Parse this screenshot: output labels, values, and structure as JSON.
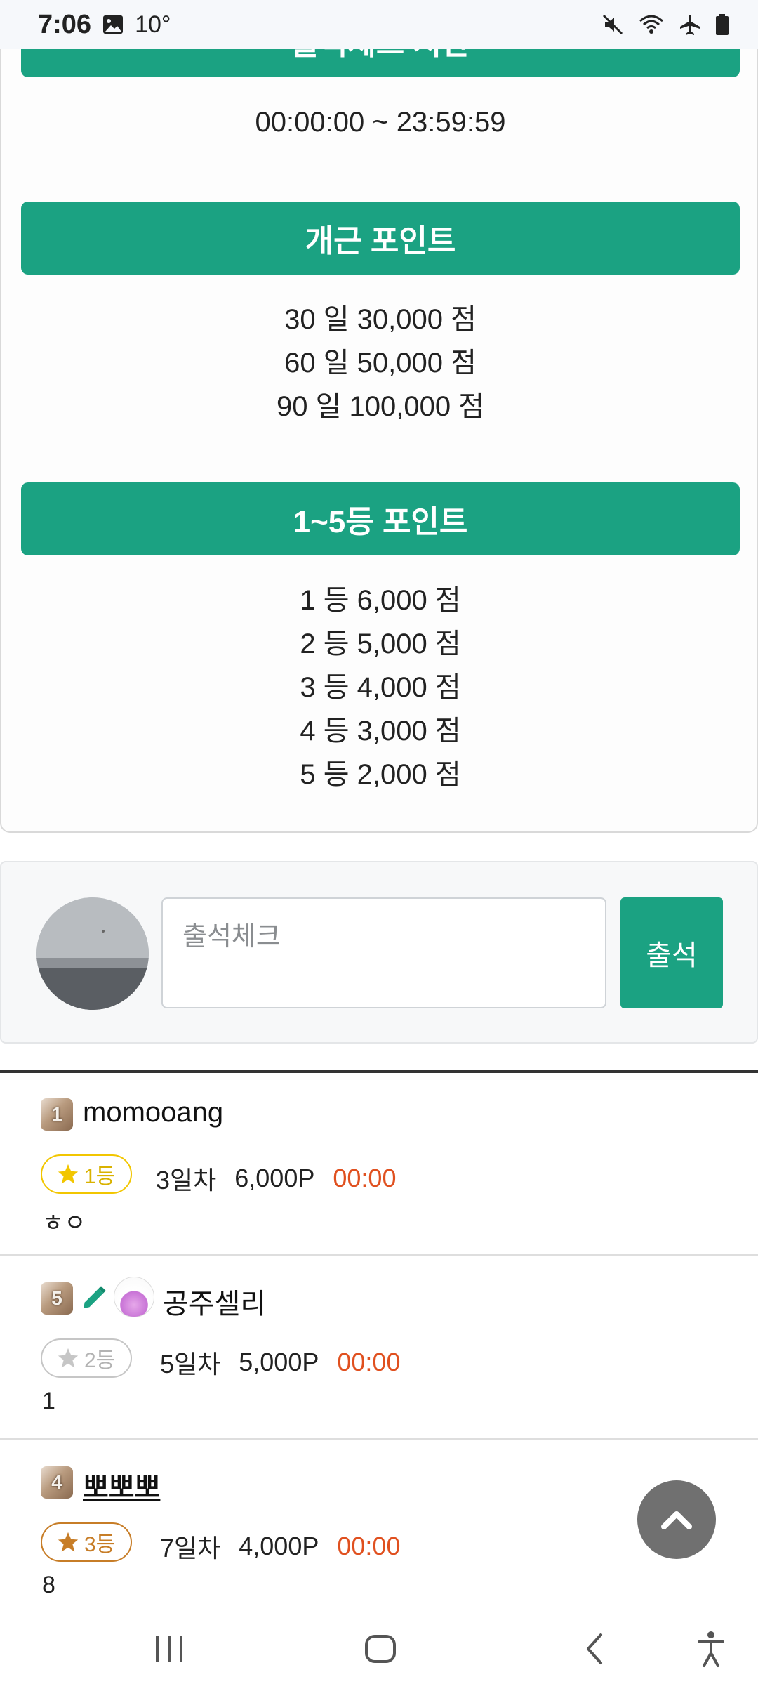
{
  "status_bar": {
    "time": "7:06",
    "temperature": "10°",
    "icons": [
      "image-icon",
      "mute-icon",
      "wifi-icon",
      "airplane-icon",
      "battery-icon"
    ]
  },
  "info": {
    "time_header": "출석체크 시간",
    "time_range": "00:00:00 ~ 23:59:59",
    "streak_header": "개근 포인트",
    "streak_points": [
      {
        "label": "30 일  30,000 점"
      },
      {
        "label": "60 일  50,000 점"
      },
      {
        "label": "90 일  100,000 점"
      }
    ],
    "rank_header": "1~5등 포인트",
    "rank_points": [
      {
        "label": "1 등  6,000 점"
      },
      {
        "label": "2 등  5,000 점"
      },
      {
        "label": "3 등  4,000 점"
      },
      {
        "label": "4 등  3,000 점"
      },
      {
        "label": "5 등  2,000 점"
      }
    ]
  },
  "checkin_form": {
    "placeholder": "출석체크",
    "button_label": "출석"
  },
  "entries": [
    {
      "level": "1",
      "name": "momooang",
      "rank": "1등",
      "days": "3일차",
      "points": "6,000P",
      "time": "00:00",
      "memo": "ㅎㅇ",
      "star_color": "#f2c600"
    },
    {
      "level": "5",
      "name": "공주셀리",
      "rank": "2등",
      "days": "5일차",
      "points": "5,000P",
      "time": "00:00",
      "memo": "1",
      "star_color": "#c6c6c6"
    },
    {
      "level": "4",
      "name": "뽀뽀뽀",
      "rank": "3등",
      "days": "7일차",
      "points": "4,000P",
      "time": "00:00",
      "memo": "8",
      "star_color": "#c77d27"
    }
  ],
  "colors": {
    "accent_green": "#1ba282",
    "time_orange": "#e0501f"
  }
}
